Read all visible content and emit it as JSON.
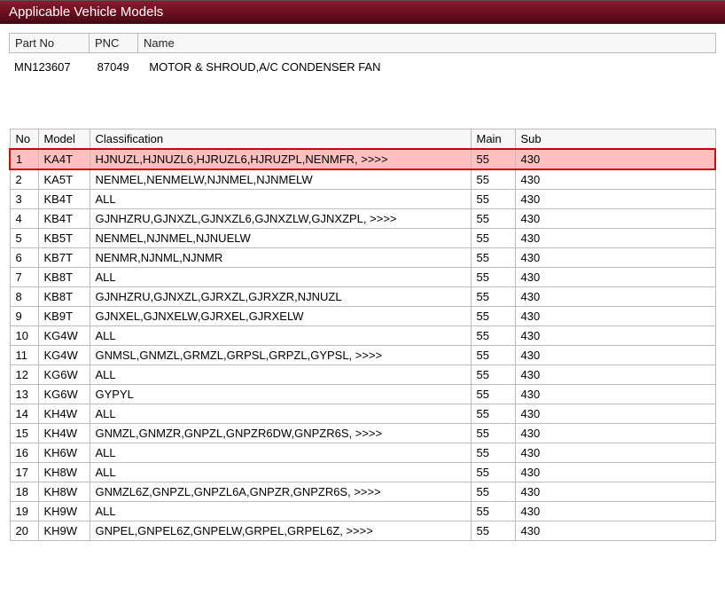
{
  "titlebar": "Applicable Vehicle Models",
  "info_headers": {
    "partno": "Part No",
    "pnc": "PNC",
    "name": "Name"
  },
  "info_values": {
    "partno": "MN123607",
    "pnc": "87049",
    "name": "MOTOR & SHROUD,A/C CONDENSER FAN"
  },
  "data_headers": {
    "no": "No",
    "model": "Model",
    "classification": "Classification",
    "main": "Main",
    "sub": "Sub"
  },
  "rows": [
    {
      "no": "1",
      "model": "KA4T",
      "classification": "HJNUZL,HJNUZL6,HJRUZL6,HJRUZPL,NENMFR,  >>>>",
      "main": "55",
      "sub": "430",
      "selected": true
    },
    {
      "no": "2",
      "model": "KA5T",
      "classification": "NENMEL,NENMELW,NJNMEL,NJNMELW",
      "main": "55",
      "sub": "430"
    },
    {
      "no": "3",
      "model": "KB4T",
      "classification": "ALL",
      "main": "55",
      "sub": "430"
    },
    {
      "no": "4",
      "model": "KB4T",
      "classification": "GJNHZRU,GJNXZL,GJNXZL6,GJNXZLW,GJNXZPL,  >>>>",
      "main": "55",
      "sub": "430"
    },
    {
      "no": "5",
      "model": "KB5T",
      "classification": "NENMEL,NJNMEL,NJNUELW",
      "main": "55",
      "sub": "430"
    },
    {
      "no": "6",
      "model": "KB7T",
      "classification": "NENMR,NJNML,NJNMR",
      "main": "55",
      "sub": "430"
    },
    {
      "no": "7",
      "model": "KB8T",
      "classification": "ALL",
      "main": "55",
      "sub": "430"
    },
    {
      "no": "8",
      "model": "KB8T",
      "classification": "GJNHZRU,GJNXZL,GJRXZL,GJRXZR,NJNUZL",
      "main": "55",
      "sub": "430"
    },
    {
      "no": "9",
      "model": "KB9T",
      "classification": "GJNXEL,GJNXELW,GJRXEL,GJRXELW",
      "main": "55",
      "sub": "430"
    },
    {
      "no": "10",
      "model": "KG4W",
      "classification": "ALL",
      "main": "55",
      "sub": "430"
    },
    {
      "no": "11",
      "model": "KG4W",
      "classification": "GNMSL,GNMZL,GRMZL,GRPSL,GRPZL,GYPSL,  >>>>",
      "main": "55",
      "sub": "430"
    },
    {
      "no": "12",
      "model": "KG6W",
      "classification": "ALL",
      "main": "55",
      "sub": "430"
    },
    {
      "no": "13",
      "model": "KG6W",
      "classification": "GYPYL",
      "main": "55",
      "sub": "430"
    },
    {
      "no": "14",
      "model": "KH4W",
      "classification": "ALL",
      "main": "55",
      "sub": "430"
    },
    {
      "no": "15",
      "model": "KH4W",
      "classification": "GNMZL,GNMZR,GNPZL,GNPZR6DW,GNPZR6S,  >>>>",
      "main": "55",
      "sub": "430"
    },
    {
      "no": "16",
      "model": "KH6W",
      "classification": "ALL",
      "main": "55",
      "sub": "430"
    },
    {
      "no": "17",
      "model": "KH8W",
      "classification": "ALL",
      "main": "55",
      "sub": "430"
    },
    {
      "no": "18",
      "model": "KH8W",
      "classification": "GNMZL6Z,GNPZL,GNPZL6A,GNPZR,GNPZR6S,  >>>>",
      "main": "55",
      "sub": "430"
    },
    {
      "no": "19",
      "model": "KH9W",
      "classification": "ALL",
      "main": "55",
      "sub": "430"
    },
    {
      "no": "20",
      "model": "KH9W",
      "classification": "GNPEL,GNPEL6Z,GNPELW,GRPEL,GRPEL6Z,  >>>>",
      "main": "55",
      "sub": "430"
    }
  ]
}
